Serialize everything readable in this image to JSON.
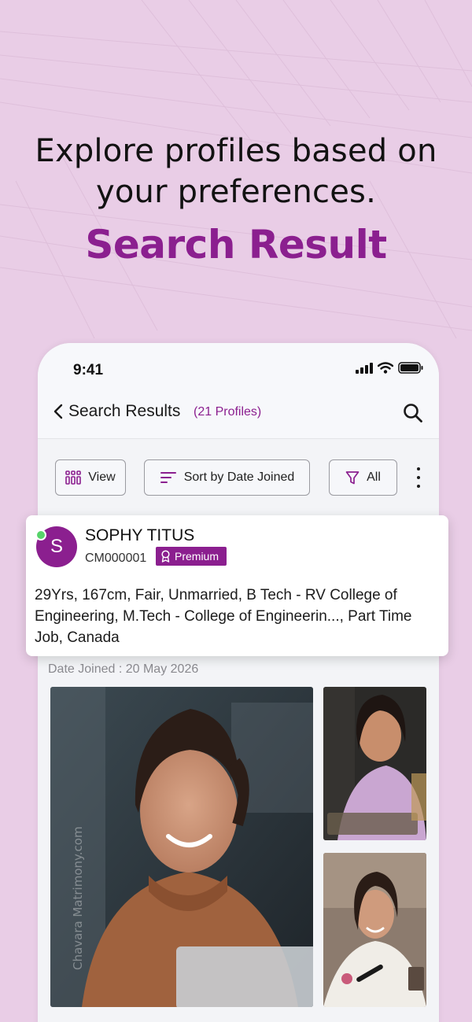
{
  "promo": {
    "headline_line1": "Explore profiles based on",
    "headline_line2": "your preferences.",
    "subheadline": "Search Result"
  },
  "status_bar": {
    "time": "9:41",
    "icons": [
      "signal-icon",
      "wifi-icon",
      "battery-icon"
    ]
  },
  "nav": {
    "back_icon": "chevron-left-icon",
    "title": "Search Results",
    "count": "(21 Profiles)",
    "search_icon": "search-icon"
  },
  "toolbar": {
    "view_label": "View",
    "sort_label": "Sort by Date Joined",
    "filter_label": "All",
    "more_icon": "kebab-menu-icon"
  },
  "profile": {
    "initial": "S",
    "name": "SOPHY TITUS",
    "id": "CM000001",
    "badge": "Premium",
    "online": true,
    "details": "29Yrs, 167cm, Fair, Unmarried, B Tech - RV College of Engineering, M.Tech - College of Engineerin..., Part Time Job, Canada",
    "date_joined": "Date Joined : 20 May 2026",
    "watermark": "Chavara Matrimony.com"
  },
  "colors": {
    "brand": "#8b1f8f",
    "background": "#e9cde6",
    "online": "#57d36a"
  }
}
